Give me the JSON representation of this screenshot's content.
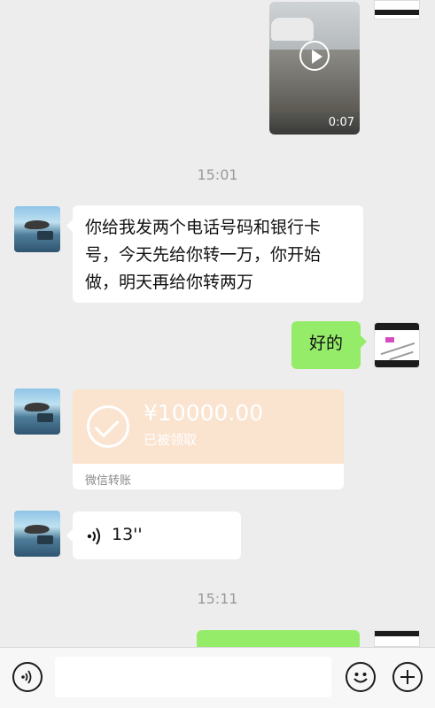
{
  "messages": {
    "video": {
      "duration": "0:07"
    },
    "time1": "15:01",
    "text_in": "你给我发两个电话号码和银行卡号，今天先给你转一万，你开始做，明天再给你转两万",
    "text_out": "好的",
    "transfer": {
      "amount": "¥10000.00",
      "status": "已被领取",
      "label": "微信转账"
    },
    "voice": {
      "duration": "13''"
    },
    "time2": "15:11"
  },
  "icons": {
    "voice_button": "voice-icon",
    "emoji_button": "emoji-icon",
    "plus_button": "plus-icon",
    "play": "play-icon",
    "check": "check-icon"
  },
  "colors": {
    "background": "#ededed",
    "bubble_out": "#95ec69",
    "transfer_top": "#fae3cf"
  }
}
